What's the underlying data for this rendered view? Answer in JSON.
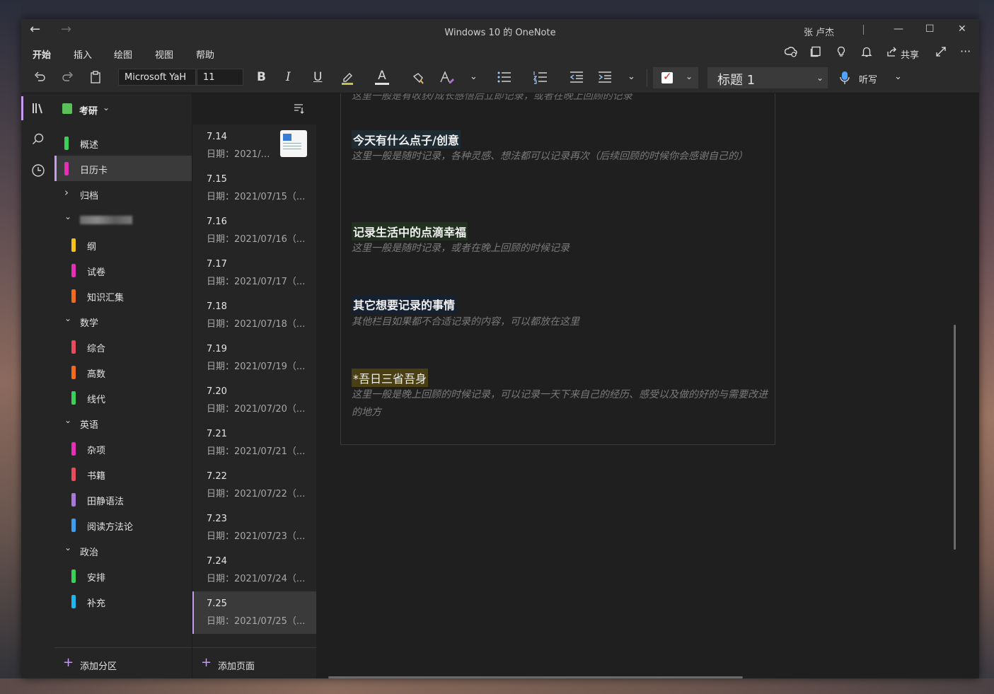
{
  "app": {
    "title": "Windows 10 的 OneNote",
    "user": "张 卢杰",
    "back_glyph": "←",
    "forward_glyph": "→",
    "minimize_glyph": "—",
    "maximize_glyph": "☐",
    "close_glyph": "✕"
  },
  "ribbon": {
    "tabs": [
      "开始",
      "插入",
      "绘图",
      "视图",
      "帮助"
    ],
    "active_tab": "开始",
    "share_label": "共享"
  },
  "toolbar": {
    "font_name": "Microsoft YaH",
    "font_size": "11",
    "bold": "B",
    "italic": "I",
    "underline": "U",
    "font_color_glyph": "A",
    "style_value": "标题 1",
    "dictate_label": "听写"
  },
  "notebook": {
    "name": "考研",
    "color": "#5cc05a"
  },
  "sections": [
    {
      "label": "概述",
      "color": "#3ad05a",
      "indent": 0,
      "type": "section"
    },
    {
      "label": "日历卡",
      "color": "#e52fb6",
      "indent": 0,
      "type": "section",
      "selected": true
    },
    {
      "label": "归档",
      "indent": 0,
      "type": "group-collapsed"
    },
    {
      "label": "",
      "indent": 0,
      "type": "group-expanded",
      "blurred": true
    },
    {
      "label": "纲",
      "color": "#f3c11a",
      "indent": 1,
      "type": "section"
    },
    {
      "label": "试卷",
      "color": "#e52fb6",
      "indent": 1,
      "type": "section"
    },
    {
      "label": "知识汇集",
      "color": "#f26a1b",
      "indent": 1,
      "type": "section"
    },
    {
      "label": "数学",
      "indent": 0,
      "type": "group-expanded"
    },
    {
      "label": "综合",
      "color": "#e84b5b",
      "indent": 1,
      "type": "section"
    },
    {
      "label": "高数",
      "color": "#f26a1b",
      "indent": 1,
      "type": "section"
    },
    {
      "label": "线代",
      "color": "#3ad05a",
      "indent": 1,
      "type": "section"
    },
    {
      "label": "英语",
      "indent": 0,
      "type": "group-expanded"
    },
    {
      "label": "杂项",
      "color": "#e52fb6",
      "indent": 1,
      "type": "section"
    },
    {
      "label": "书籍",
      "color": "#e84b5b",
      "indent": 1,
      "type": "section"
    },
    {
      "label": "田静语法",
      "color": "#a678d8",
      "indent": 1,
      "type": "section"
    },
    {
      "label": "阅读方法论",
      "color": "#3b9cf0",
      "indent": 1,
      "type": "section"
    },
    {
      "label": "政治",
      "indent": 0,
      "type": "group-expanded"
    },
    {
      "label": "安排",
      "color": "#3ad05a",
      "indent": 1,
      "type": "section"
    },
    {
      "label": "补充",
      "color": "#1fb6f0",
      "indent": 1,
      "type": "section"
    }
  ],
  "add_section_label": "添加分区",
  "pages": [
    {
      "title": "7.14",
      "date": "日期：2021/0...",
      "thumbnail": true
    },
    {
      "title": "7.15",
      "date": "日期：2021/07/15（..."
    },
    {
      "title": "7.16",
      "date": "日期：2021/07/16（..."
    },
    {
      "title": "7.17",
      "date": "日期：2021/07/17（..."
    },
    {
      "title": "7.18",
      "date": "日期：2021/07/18（..."
    },
    {
      "title": "7.19",
      "date": "日期：2021/07/19（..."
    },
    {
      "title": "7.20",
      "date": "日期：2021/07/20（..."
    },
    {
      "title": "7.21",
      "date": "日期：2021/07/21（..."
    },
    {
      "title": "7.22",
      "date": "日期：2021/07/22（..."
    },
    {
      "title": "7.23",
      "date": "日期：2021/07/23（..."
    },
    {
      "title": "7.24",
      "date": "日期：2021/07/24（..."
    },
    {
      "title": "7.25",
      "date": "日期：2021/07/25（...",
      "selected": true
    }
  ],
  "add_page_label": "添加页面",
  "note": {
    "clipped_text": "这里一般是有收获/成长感悟后立即记录，或者在晚上回顾的记录",
    "blocks": [
      {
        "heading": "今天有什么点子/创意",
        "hint": "这里一般是随时记录，各种灵感、想法都可以记录再次（后续回顾的时候你会感谢自己的）"
      },
      {
        "heading": "记录生活中的点滴幸福",
        "hint": "这里一般是随时记录，或者在晚上回顾的时候记录"
      },
      {
        "heading": "其它想要记录的事情",
        "hint": "其他栏目如果都不合适记录的内容，可以都放在这里"
      },
      {
        "heading": "*吾日三省吾身",
        "hint": "这里一般是晚上回顾的时候记录，可以记录一天下来自己的经历、感受以及做的好的与需要改进的地方"
      }
    ]
  },
  "icons": {
    "undo": "undo-icon",
    "redo": "redo-icon",
    "clipboard": "clipboard-icon",
    "highlighter": "highlighter-icon",
    "format-painter": "format-painter-icon",
    "clear-format": "clear-formatting-icon",
    "bullets": "bulleted-list-icon",
    "numbering": "numbered-list-icon",
    "outdent": "outdent-icon",
    "indent": "indent-icon",
    "microphone": "microphone-icon"
  },
  "colors": {
    "accent": "#c49cf0",
    "checkbox_tick": "#d6202a"
  }
}
